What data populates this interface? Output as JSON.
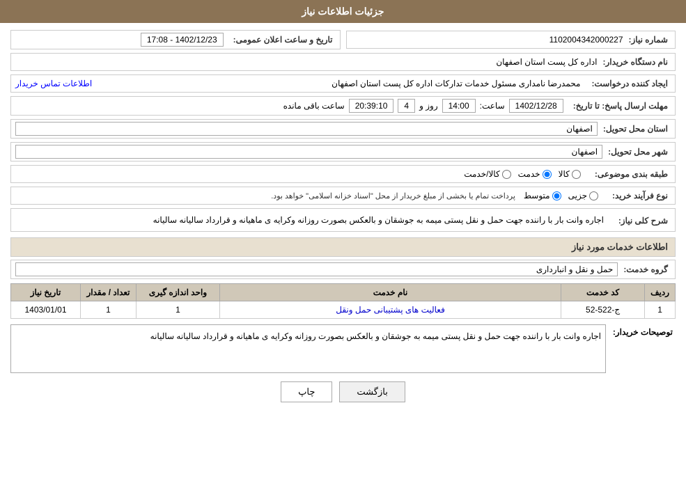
{
  "header": {
    "title": "جزئیات اطلاعات نیاز"
  },
  "fields": {
    "need_number_label": "شماره نیاز:",
    "need_number_value": "1102004342000227",
    "date_announce_label": "تاریخ و ساعت اعلان عمومی:",
    "date_announce_value": "1402/12/23 - 17:08",
    "buyer_org_label": "نام دستگاه خریدار:",
    "buyer_org_value": "اداره کل پست استان اصفهان",
    "creator_label": "ایجاد کننده درخواست:",
    "creator_value": "محمدرضا نامداری مسئول خدمات تدارکات اداره کل پست استان اصفهان",
    "creator_contact_link": "اطلاعات تماس خریدار",
    "deadline_label": "مهلت ارسال پاسخ: تا تاریخ:",
    "deadline_date": "1402/12/28",
    "deadline_time_label": "ساعت:",
    "deadline_time": "14:00",
    "deadline_days_label": "روز و",
    "deadline_days": "4",
    "deadline_remaining_label": "ساعت باقی مانده",
    "deadline_remaining": "20:39:10",
    "delivery_province_label": "استان محل تحویل:",
    "delivery_province_value": "اصفهان",
    "delivery_city_label": "شهر محل تحویل:",
    "delivery_city_value": "اصفهان",
    "category_label": "طبقه بندی موضوعی:",
    "category_options": [
      "کالا",
      "خدمت",
      "کالا/خدمت"
    ],
    "category_selected": "خدمت",
    "process_label": "نوع فرآیند خرید:",
    "process_options": [
      "جزیی",
      "متوسط"
    ],
    "process_selected": "متوسط",
    "process_note": "پرداخت تمام یا بخشی از مبلغ خریدار از محل \"اسناد خزانه اسلامی\" خواهد بود.",
    "general_desc_label": "شرح کلی نیاز:",
    "general_desc_value": "اجاره وانت بار با راننده جهت حمل و نقل پستی میمه به جوشقان و بالعکس بصورت روزانه وکرایه ی ماهیانه و قرارداد سالیانه سالیانه",
    "services_info_title": "اطلاعات خدمات مورد نیاز",
    "service_group_label": "گروه خدمت:",
    "service_group_value": "حمل و نقل و انبارداری",
    "table": {
      "columns": [
        "ردیف",
        "کد خدمت",
        "نام خدمت",
        "واحد اندازه گیری",
        "تعداد / مقدار",
        "تاریخ نیاز"
      ],
      "rows": [
        {
          "index": "1",
          "code": "ج-522-52",
          "name": "فعالیت های پشتیبانی حمل ونقل",
          "unit": "1",
          "qty": "1",
          "date": "1403/01/01"
        }
      ]
    },
    "buyer_desc_label": "توصیحات خریدار:",
    "buyer_desc_value": "اجاره وانت بار با راننده جهت حمل و نقل پستی میمه به جوشقان و بالعکس بصورت روزانه وکرایه ی ماهیانه و قرارداد سالیانه سالیانه"
  },
  "buttons": {
    "print_label": "چاپ",
    "back_label": "بازگشت"
  }
}
